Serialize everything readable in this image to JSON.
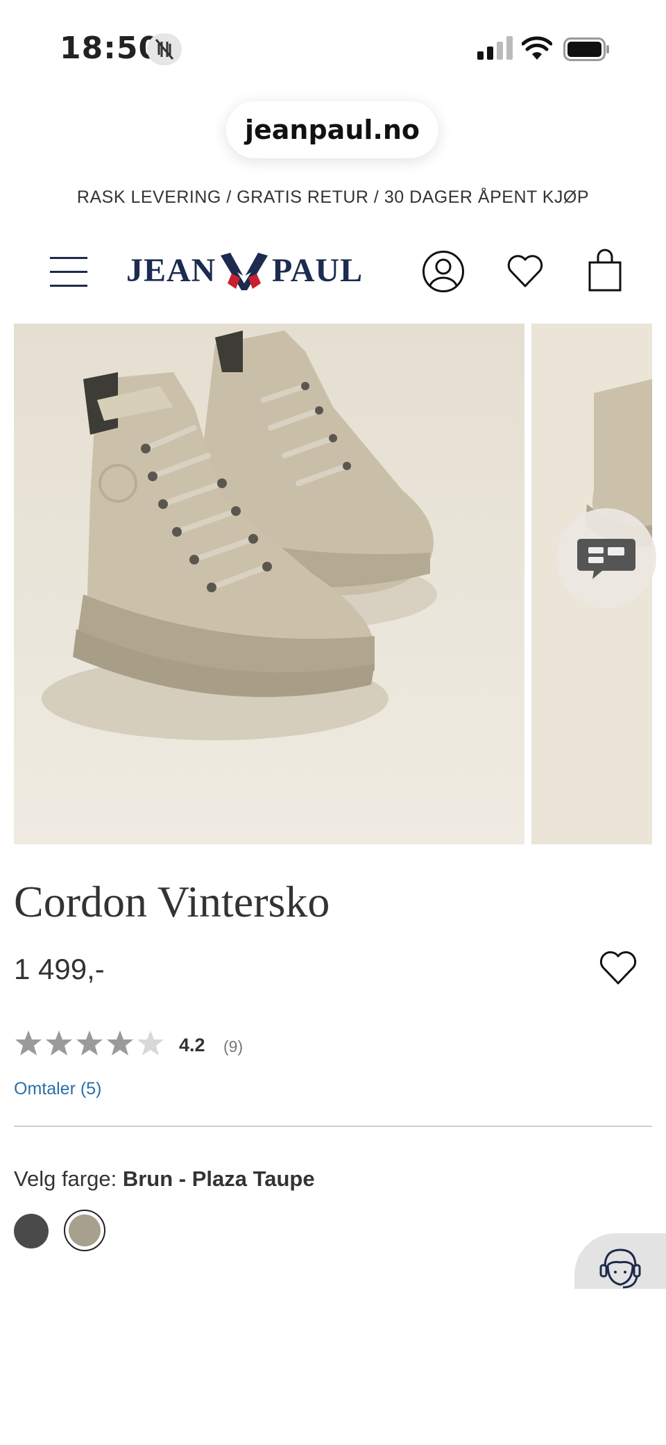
{
  "status_bar": {
    "time": "18:50"
  },
  "browser": {
    "url": "jeanpaul.no"
  },
  "promo": {
    "text": "RASK LEVERING / GRATIS RETUR / 30 DAGER ÅPENT KJØP"
  },
  "header": {
    "logo_left": "JEAN",
    "logo_right": "PAUL"
  },
  "product": {
    "title": "Cordon Vintersko",
    "price": "1 499,-",
    "rating": 4.2,
    "rating_display": "4.2",
    "rating_count": "(9)",
    "reviews_link": "Omtaler (5)",
    "color_label": "Velg farge:",
    "color_selected": "Brun - Plaza Taupe",
    "colors": [
      {
        "name": "dark-grey",
        "hex": "#4a4a4a",
        "selected": false
      },
      {
        "name": "taupe",
        "hex": "#a8a08f",
        "selected": true
      }
    ]
  },
  "colors": {
    "brand_navy": "#1c2b4f",
    "link_blue": "#2a6fa8",
    "star_grey": "#9a9a9a"
  }
}
